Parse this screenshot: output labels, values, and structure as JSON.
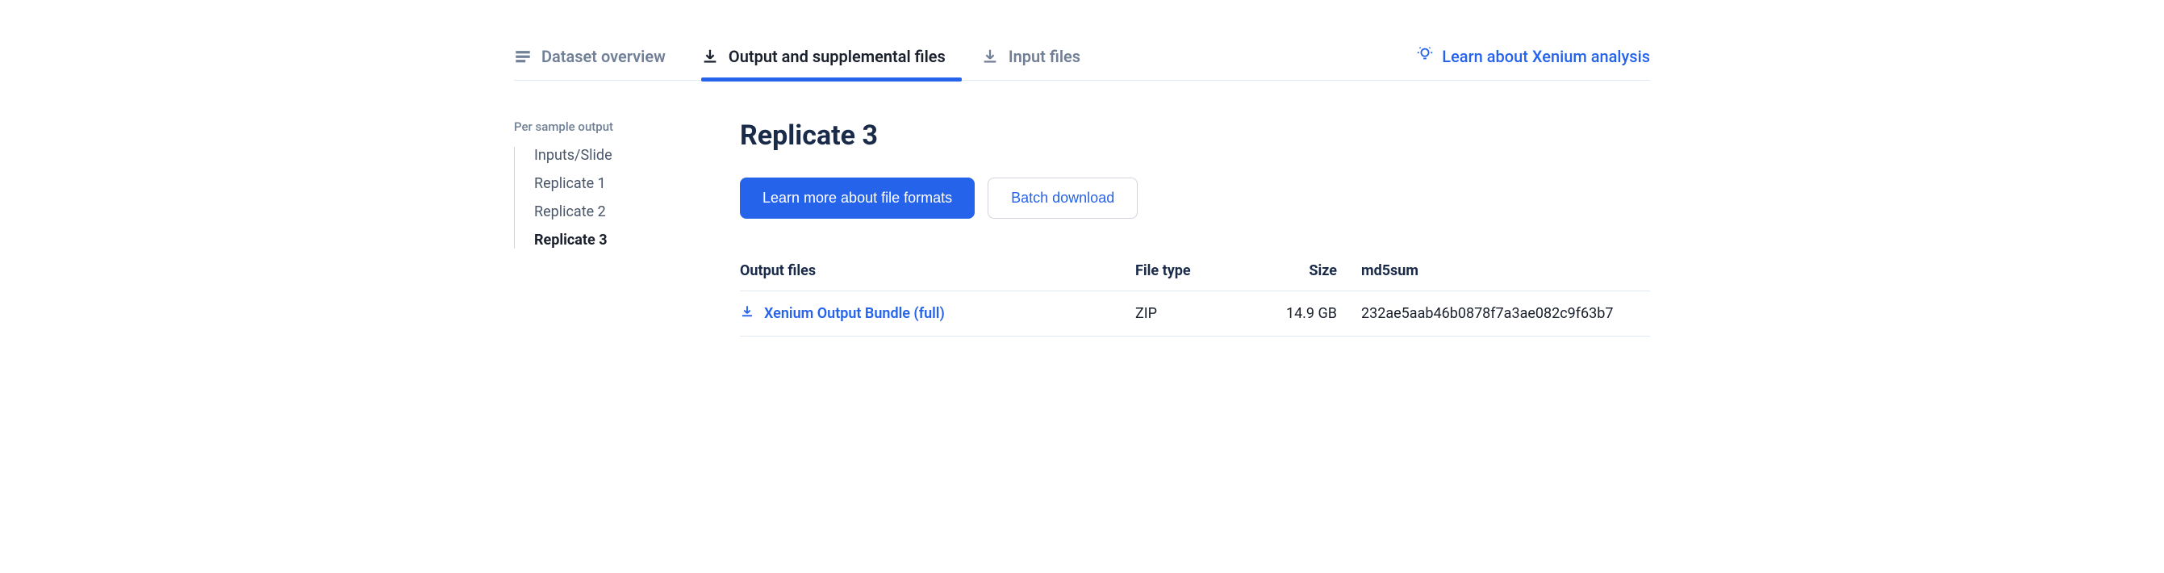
{
  "tabs": {
    "overview": "Dataset overview",
    "output": "Output and supplemental files",
    "input": "Input files"
  },
  "learn_link": "Learn about Xenium analysis",
  "sidebar": {
    "title": "Per sample output",
    "items": [
      {
        "label": "Inputs/Slide",
        "active": false
      },
      {
        "label": "Replicate 1",
        "active": false
      },
      {
        "label": "Replicate 2",
        "active": false
      },
      {
        "label": "Replicate 3",
        "active": true
      }
    ]
  },
  "main": {
    "title": "Replicate 3",
    "btn_primary": "Learn more about file formats",
    "btn_secondary": "Batch download"
  },
  "table": {
    "headers": {
      "output": "Output files",
      "type": "File type",
      "size": "Size",
      "md5": "md5sum"
    },
    "rows": [
      {
        "name": "Xenium Output Bundle (full)",
        "type": "ZIP",
        "size": "14.9 GB",
        "md5": "232ae5aab46b0878f7a3ae082c9f63b7"
      }
    ]
  }
}
